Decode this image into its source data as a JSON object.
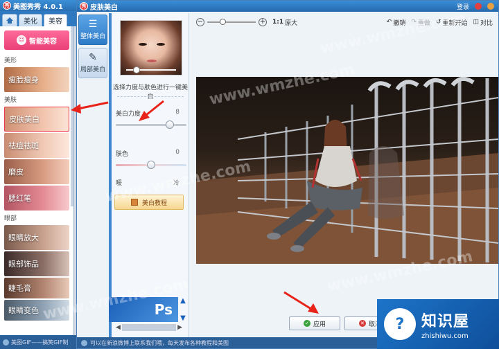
{
  "main_window": {
    "title": "美图秀秀 4.0.1",
    "tabs": [
      "美化",
      "美容"
    ],
    "smart_button": "智能美容",
    "sections": {
      "shape": "美形",
      "skin": "美肤",
      "eyes": "眼部"
    },
    "shape_items": [
      "瘦脸瘦身"
    ],
    "skin_items": [
      "皮肤美白",
      "祛痘祛斑",
      "磨皮",
      "腮红笔"
    ],
    "eye_items": [
      "眼睛放大",
      "眼部饰品",
      "睫毛膏",
      "眼睛变色"
    ],
    "status_text": "美图GIF——搞笑GIF制"
  },
  "dialog": {
    "title": "皮肤美白",
    "title_right": "登录",
    "side_tabs": [
      {
        "label": "整体美白",
        "icon": "sliders-icon"
      },
      {
        "label": "局部美白",
        "icon": "brush-icon"
      }
    ],
    "instruction": "选择力度与肤色进行一键美白",
    "whitening": {
      "label": "美白力度",
      "value": "8",
      "level": 0.8
    },
    "skin_color": {
      "label": "肤色",
      "value": "0",
      "level": 0.5
    },
    "tone": {
      "warm": "暖",
      "cool": "冷"
    },
    "tutorial_button": "美白教程",
    "toolbar": {
      "ratio": "1:1",
      "original": "原大",
      "undo": "撤销",
      "redo": "重做",
      "restart": "重新开始",
      "compare": "对比"
    },
    "apply_button": "应用",
    "cancel_button": "取消",
    "status_text": "可以在新浪微博上联系我们哦，每天发布各种教程和美图",
    "ps_logo": "Ps"
  },
  "watermark": {
    "text": "www.wmzhe.com",
    "badge_title": "知识屋",
    "badge_sub": "zhishiwu.com"
  },
  "colors": {
    "titlebar": "#2a6fb3",
    "accent_pink": "#e94078",
    "arrow_red": "#e8231a",
    "badge_blue": "#1d74c9"
  }
}
